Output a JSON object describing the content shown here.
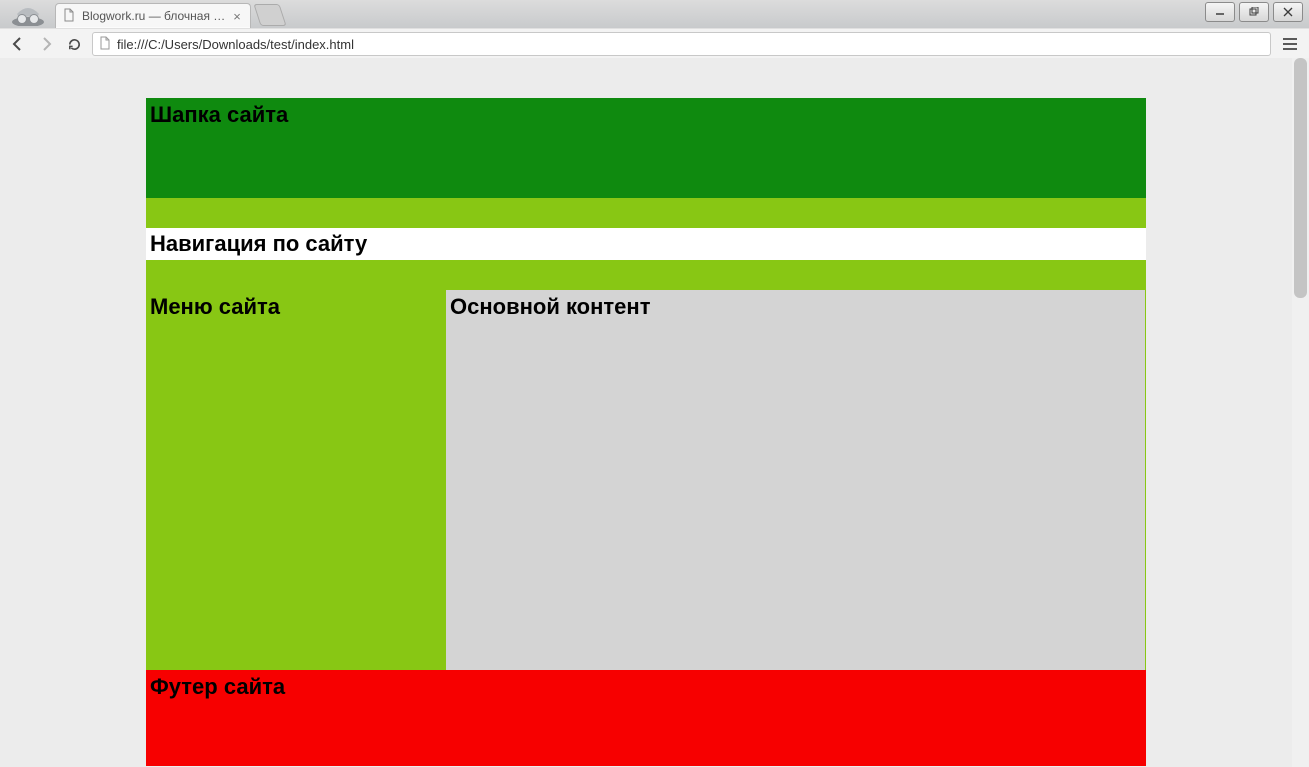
{
  "browser": {
    "tab_title": "Blogwork.ru — блочная вер",
    "url": "file:///C:/Users/Downloads/test/index.html"
  },
  "page": {
    "header": "Шапка сайта",
    "nav": "Навигация по сайту",
    "sidebar": "Меню сайта",
    "content": "Основной контент",
    "footer": "Футер сайта"
  }
}
